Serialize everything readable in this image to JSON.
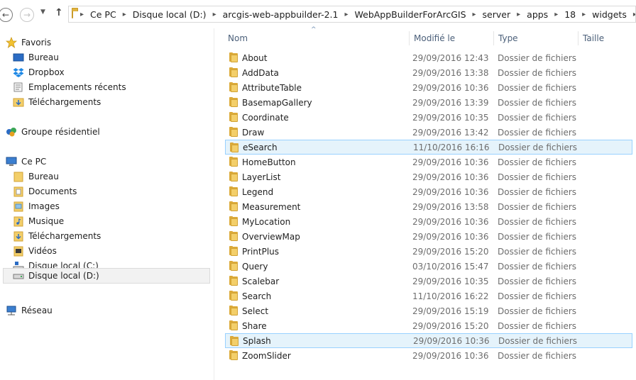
{
  "address": {
    "crumbs": [
      "Ce PC",
      "Disque local (D:)",
      "arcgis-web-appbuilder-2.1",
      "WebAppBuilderForArcGIS",
      "server",
      "apps",
      "18",
      "widgets"
    ]
  },
  "sidebar": {
    "favoris": "Favoris",
    "bureau": "Bureau",
    "dropbox": "Dropbox",
    "emplacements": "Emplacements récents",
    "telechargements": "Téléchargements",
    "groupe": "Groupe résidentiel",
    "cepc": "Ce PC",
    "pc_bureau": "Bureau",
    "documents": "Documents",
    "images": "Images",
    "musique": "Musique",
    "pc_telechargements": "Téléchargements",
    "videos": "Vidéos",
    "disque_c": "Disque local (C:)",
    "disque_d": "Disque local (D:)",
    "reseau": "Réseau"
  },
  "columns": {
    "name": "Nom",
    "modified": "Modifié le",
    "type": "Type",
    "size": "Taille"
  },
  "files": [
    {
      "name": "About",
      "date": "29/09/2016 12:43",
      "type": "Dossier de fichiers"
    },
    {
      "name": "AddData",
      "date": "29/09/2016 13:38",
      "type": "Dossier de fichiers"
    },
    {
      "name": "AttributeTable",
      "date": "29/09/2016 10:36",
      "type": "Dossier de fichiers"
    },
    {
      "name": "BasemapGallery",
      "date": "29/09/2016 13:39",
      "type": "Dossier de fichiers"
    },
    {
      "name": "Coordinate",
      "date": "29/09/2016 10:35",
      "type": "Dossier de fichiers"
    },
    {
      "name": "Draw",
      "date": "29/09/2016 13:42",
      "type": "Dossier de fichiers"
    },
    {
      "name": "eSearch",
      "date": "11/10/2016 16:16",
      "type": "Dossier de fichiers"
    },
    {
      "name": "HomeButton",
      "date": "29/09/2016 10:36",
      "type": "Dossier de fichiers"
    },
    {
      "name": "LayerList",
      "date": "29/09/2016 10:36",
      "type": "Dossier de fichiers"
    },
    {
      "name": "Legend",
      "date": "29/09/2016 10:36",
      "type": "Dossier de fichiers"
    },
    {
      "name": "Measurement",
      "date": "29/09/2016 13:58",
      "type": "Dossier de fichiers"
    },
    {
      "name": "MyLocation",
      "date": "29/09/2016 10:36",
      "type": "Dossier de fichiers"
    },
    {
      "name": "OverviewMap",
      "date": "29/09/2016 10:36",
      "type": "Dossier de fichiers"
    },
    {
      "name": "PrintPlus",
      "date": "29/09/2016 15:20",
      "type": "Dossier de fichiers"
    },
    {
      "name": "Query",
      "date": "03/10/2016 15:47",
      "type": "Dossier de fichiers"
    },
    {
      "name": "Scalebar",
      "date": "29/09/2016 10:35",
      "type": "Dossier de fichiers"
    },
    {
      "name": "Search",
      "date": "11/10/2016 16:22",
      "type": "Dossier de fichiers"
    },
    {
      "name": "Select",
      "date": "29/09/2016 15:19",
      "type": "Dossier de fichiers"
    },
    {
      "name": "Share",
      "date": "29/09/2016 15:20",
      "type": "Dossier de fichiers"
    },
    {
      "name": "Splash",
      "date": "29/09/2016 10:36",
      "type": "Dossier de fichiers"
    },
    {
      "name": "ZoomSlider",
      "date": "29/09/2016 10:36",
      "type": "Dossier de fichiers"
    }
  ],
  "icons": {
    "back": "back-arrow-icon",
    "forward": "forward-arrow-icon",
    "up": "up-arrow-icon",
    "folder": "folder-icon"
  }
}
